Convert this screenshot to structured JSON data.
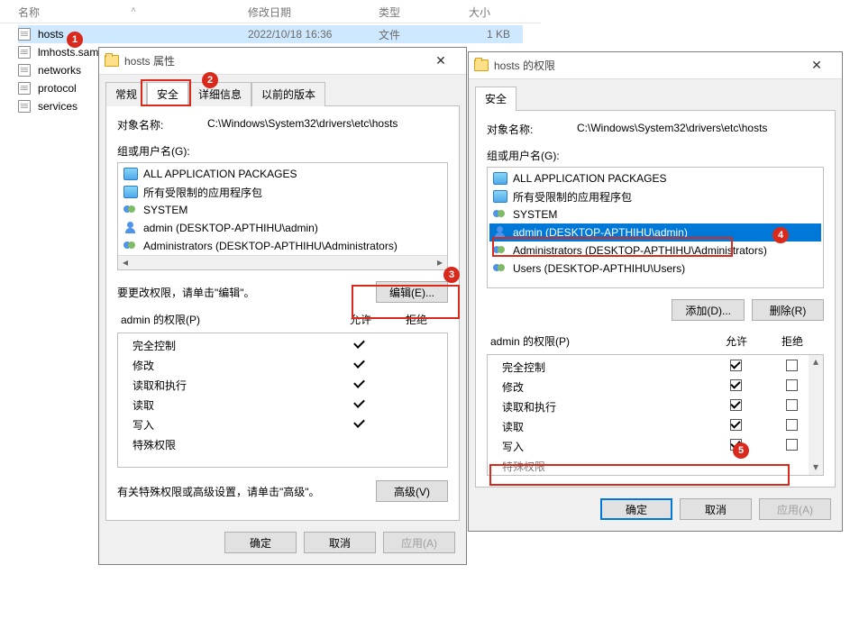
{
  "explorer": {
    "columns": {
      "name": "名称",
      "date": "修改日期",
      "type": "类型",
      "size": "大小"
    },
    "files": [
      {
        "name": "hosts",
        "date": "2022/10/18 16:36",
        "type": "文件",
        "size": "1 KB",
        "selected": true
      },
      {
        "name": "lmhosts.sam",
        "date": "",
        "type": "",
        "size": ""
      },
      {
        "name": "networks",
        "date": "",
        "type": "",
        "size": ""
      },
      {
        "name": "protocol",
        "date": "",
        "type": "",
        "size": ""
      },
      {
        "name": "services",
        "date": "",
        "type": "",
        "size": ""
      }
    ]
  },
  "props_dialog": {
    "title": "hosts 属性",
    "tabs": {
      "general": "常规",
      "security": "安全",
      "details": "详细信息",
      "previous": "以前的版本"
    },
    "object_label": "对象名称:",
    "object_value": "C:\\Windows\\System32\\drivers\\etc\\hosts",
    "groups_label": "组或用户名(G):",
    "groups": [
      {
        "icon": "pkg",
        "text": "ALL APPLICATION PACKAGES"
      },
      {
        "icon": "pkg",
        "text": "所有受限制的应用程序包"
      },
      {
        "icon": "group",
        "text": "SYSTEM"
      },
      {
        "icon": "user",
        "text": "admin (DESKTOP-APTHIHU\\admin)"
      },
      {
        "icon": "group",
        "text": "Administrators (DESKTOP-APTHIHU\\Administrators)"
      }
    ],
    "edit_hint": "要更改权限，请单击\"编辑\"。",
    "edit_btn": "编辑(E)...",
    "perm_title": "admin 的权限(P)",
    "perm_cols": {
      "allow": "允许",
      "deny": "拒绝"
    },
    "perm_rows": [
      {
        "name": "完全控制",
        "allow": true,
        "deny": false
      },
      {
        "name": "修改",
        "allow": true,
        "deny": false
      },
      {
        "name": "读取和执行",
        "allow": true,
        "deny": false
      },
      {
        "name": "读取",
        "allow": true,
        "deny": false
      },
      {
        "name": "写入",
        "allow": true,
        "deny": false
      },
      {
        "name": "特殊权限",
        "allow": false,
        "deny": false
      }
    ],
    "adv_hint": "有关特殊权限或高级设置，请单击\"高级\"。",
    "adv_btn": "高级(V)",
    "ok": "确定",
    "cancel": "取消",
    "apply": "应用(A)"
  },
  "perm_dialog": {
    "title": "hosts 的权限",
    "tab_security": "安全",
    "object_label": "对象名称:",
    "object_value": "C:\\Windows\\System32\\drivers\\etc\\hosts",
    "groups_label": "组或用户名(G):",
    "groups": [
      {
        "icon": "pkg",
        "text": "ALL APPLICATION PACKAGES",
        "selected": false
      },
      {
        "icon": "pkg",
        "text": "所有受限制的应用程序包",
        "selected": false
      },
      {
        "icon": "group",
        "text": "SYSTEM",
        "selected": false
      },
      {
        "icon": "user",
        "text": "admin (DESKTOP-APTHIHU\\admin)",
        "selected": true
      },
      {
        "icon": "group",
        "text": "Administrators (DESKTOP-APTHIHU\\Administrators)",
        "selected": false
      },
      {
        "icon": "group",
        "text": "Users (DESKTOP-APTHIHU\\Users)",
        "selected": false
      }
    ],
    "add_btn": "添加(D)...",
    "remove_btn": "删除(R)",
    "perm_title": "admin 的权限(P)",
    "perm_cols": {
      "allow": "允许",
      "deny": "拒绝"
    },
    "perm_rows": [
      {
        "name": "完全控制",
        "allow": true,
        "deny": false
      },
      {
        "name": "修改",
        "allow": true,
        "deny": false
      },
      {
        "name": "读取和执行",
        "allow": true,
        "deny": false
      },
      {
        "name": "读取",
        "allow": true,
        "deny": false
      },
      {
        "name": "写入",
        "allow": true,
        "deny": false
      },
      {
        "name": "特殊权限",
        "allow": false,
        "deny": false
      }
    ],
    "ok": "确定",
    "cancel": "取消",
    "apply": "应用(A)"
  },
  "callouts": {
    "c1": "1",
    "c2": "2",
    "c3": "3",
    "c4": "4",
    "c5": "5"
  }
}
